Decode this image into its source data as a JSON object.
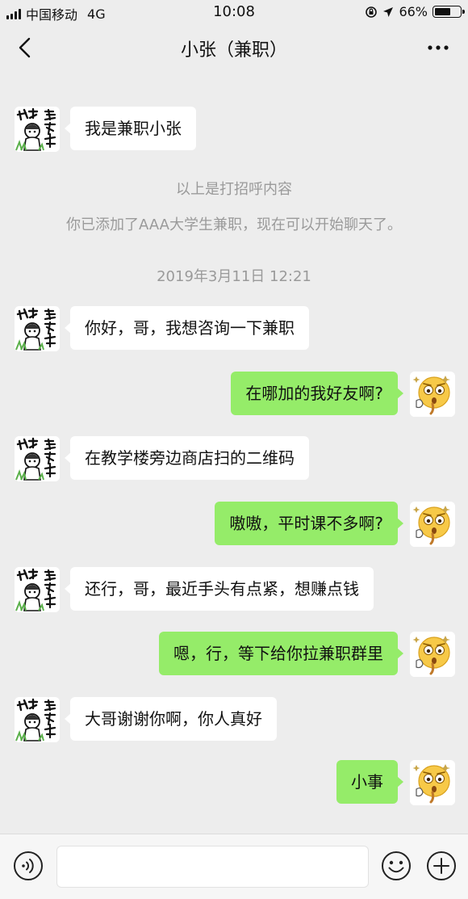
{
  "status_bar": {
    "carrier": "中国移动",
    "network": "4G",
    "time": "10:08",
    "battery": "66%",
    "battery_level": 0.66,
    "icons": [
      "signal-icon",
      "rotation-lock-icon",
      "location-arrow-icon",
      "battery-icon"
    ]
  },
  "header": {
    "title": "小张（兼职）",
    "icons": [
      "back-chevron-icon",
      "more-dots-icon"
    ]
  },
  "system": {
    "greeting_note": "以上是打招呼内容",
    "added_note": "你已添加了AAA大学生兼职，现在可以开始聊天了。",
    "timestamp": "2019年3月11日 12:21"
  },
  "messages": [
    {
      "from": "them",
      "text": "我是兼职小张"
    },
    {
      "from": "them",
      "text": "你好，哥，我想咨询一下兼职"
    },
    {
      "from": "me",
      "text": "在哪加的我好友啊?"
    },
    {
      "from": "them",
      "text": "在教学楼旁边商店扫的二维码"
    },
    {
      "from": "me",
      "text": "嗷嗷，平时课不多啊?"
    },
    {
      "from": "them",
      "text": "还行，哥，最近手头有点紧，想赚点钱"
    },
    {
      "from": "me",
      "text": "嗯，行，等下给你拉兼职群里"
    },
    {
      "from": "them",
      "text": "大哥谢谢你啊，你人真好"
    },
    {
      "from": "me",
      "text": "小事"
    }
  ],
  "avatars": {
    "them": "manga-sticker-avatar",
    "me": "sweating-emoji-avatar"
  },
  "input_bar": {
    "value": "",
    "icons": [
      "voice-icon",
      "emoji-icon",
      "plus-icon"
    ]
  },
  "colors": {
    "background": "#ededed",
    "outgoing_bubble": "#95ec69",
    "incoming_bubble": "#ffffff",
    "system_text": "#9a9a9a"
  }
}
